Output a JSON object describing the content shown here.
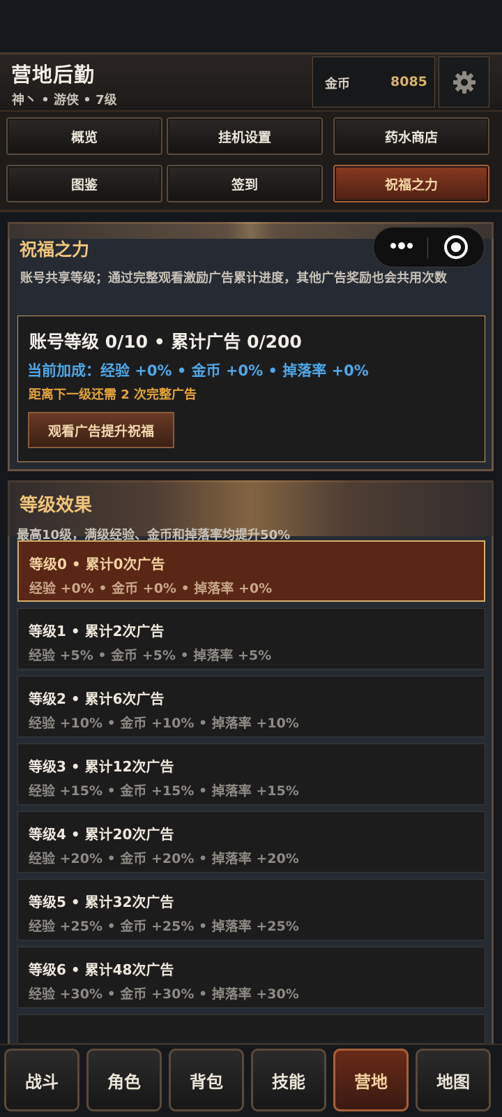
{
  "header": {
    "title": "营地后勤",
    "subtitle": "神丶 • 游侠 • 7级",
    "gold_label": "金币",
    "gold_value": "8085",
    "settings_icon": "gear-icon"
  },
  "nav": {
    "items": [
      {
        "label": "概览",
        "active": false
      },
      {
        "label": "挂机设置",
        "active": false
      },
      {
        "label": "药水商店",
        "active": false
      },
      {
        "label": "图鉴",
        "active": false
      },
      {
        "label": "签到",
        "active": false
      },
      {
        "label": "祝福之力",
        "active": true
      }
    ]
  },
  "mini_program": {
    "more_icon": "more-dots-icon",
    "close_icon": "target-icon"
  },
  "blessing": {
    "title": "祝福之力",
    "description": "账号共享等级；通过完整观看激励广告累计进度，其他广告奖励也会共用次数",
    "account_line": "账号等级 0/10 • 累计广告 0/200",
    "bonus_line": "当前加成：经验 +0% • 金币 +0% • 掉落率 +0%",
    "next_line": "距离下一级还需 2 次完整广告",
    "watch_button": "观看广告提升祝福"
  },
  "levels": {
    "title": "等级效果",
    "description": "最高10级，满级经验、金币和掉落率均提升50%",
    "items": [
      {
        "title": "等级0 • 累计0次广告",
        "effects": "经验 +0% • 金币 +0% • 掉落率 +0%",
        "active": true
      },
      {
        "title": "等级1 • 累计2次广告",
        "effects": "经验 +5% • 金币 +5% • 掉落率 +5%",
        "active": false
      },
      {
        "title": "等级2 • 累计6次广告",
        "effects": "经验 +10% • 金币 +10% • 掉落率 +10%",
        "active": false
      },
      {
        "title": "等级3 • 累计12次广告",
        "effects": "经验 +15% • 金币 +15% • 掉落率 +15%",
        "active": false
      },
      {
        "title": "等级4 • 累计20次广告",
        "effects": "经验 +20% • 金币 +20% • 掉落率 +20%",
        "active": false
      },
      {
        "title": "等级5 • 累计32次广告",
        "effects": "经验 +25% • 金币 +25% • 掉落率 +25%",
        "active": false
      },
      {
        "title": "等级6 • 累计48次广告",
        "effects": "经验 +30% • 金币 +30% • 掉落率 +30%",
        "active": false
      }
    ]
  },
  "tabbar": {
    "items": [
      {
        "label": "战斗",
        "active": false
      },
      {
        "label": "角色",
        "active": false
      },
      {
        "label": "背包",
        "active": false
      },
      {
        "label": "技能",
        "active": false
      },
      {
        "label": "营地",
        "active": true
      },
      {
        "label": "地图",
        "active": false
      }
    ]
  },
  "colors": {
    "accent_gold": "#f0c47a",
    "bonus_blue": "#4fa8e8",
    "next_orange": "#e6a43a",
    "active_red": "#5a2615"
  }
}
